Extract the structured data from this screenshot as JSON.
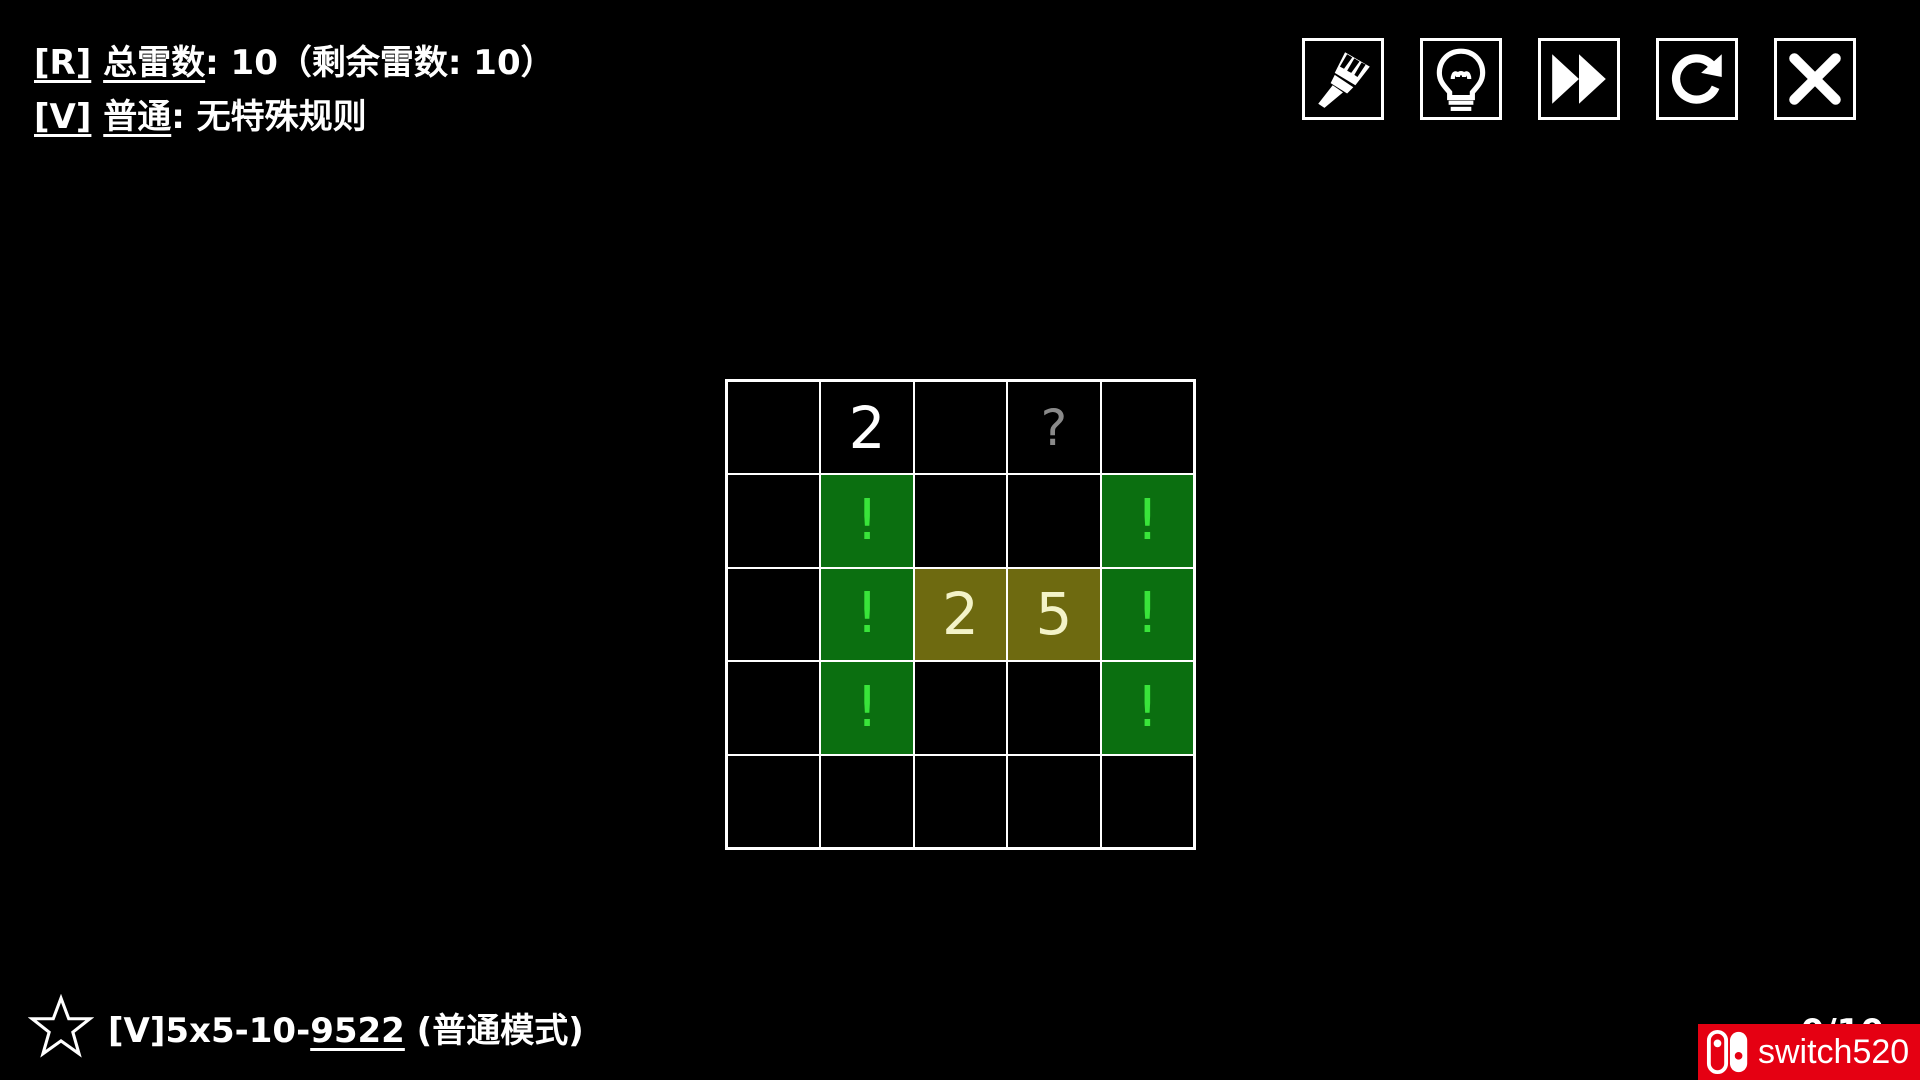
{
  "info": {
    "line1_key": "[R]",
    "line1_label": "总雷数",
    "line1_text": ":  10（剩余雷数: 10）",
    "line2_key": "[V]",
    "line2_label": "普通",
    "line2_text": ": 无特殊规则"
  },
  "toolbar": {
    "buttons": [
      {
        "name": "brush",
        "icon": "brush-icon"
      },
      {
        "name": "hint",
        "icon": "lightbulb-icon"
      },
      {
        "name": "skip",
        "icon": "fast-forward-icon"
      },
      {
        "name": "restart",
        "icon": "refresh-icon"
      },
      {
        "name": "close",
        "icon": "close-icon"
      }
    ]
  },
  "board": {
    "rows": 5,
    "cols": 5,
    "cells": [
      [
        {
          "type": "empty",
          "text": ""
        },
        {
          "type": "number",
          "text": "2"
        },
        {
          "type": "empty",
          "text": ""
        },
        {
          "type": "unknown",
          "text": "?"
        },
        {
          "type": "empty",
          "text": ""
        }
      ],
      [
        {
          "type": "empty",
          "text": ""
        },
        {
          "type": "flag",
          "text": "!"
        },
        {
          "type": "empty",
          "text": ""
        },
        {
          "type": "empty",
          "text": ""
        },
        {
          "type": "flag",
          "text": "!"
        }
      ],
      [
        {
          "type": "empty",
          "text": ""
        },
        {
          "type": "flag",
          "text": "!"
        },
        {
          "type": "highlight",
          "text": "2"
        },
        {
          "type": "highlight",
          "text": "5"
        },
        {
          "type": "flag",
          "text": "!"
        }
      ],
      [
        {
          "type": "empty",
          "text": ""
        },
        {
          "type": "flag",
          "text": "!"
        },
        {
          "type": "empty",
          "text": ""
        },
        {
          "type": "empty",
          "text": ""
        },
        {
          "type": "flag",
          "text": "!"
        }
      ],
      [
        {
          "type": "empty",
          "text": ""
        },
        {
          "type": "empty",
          "text": ""
        },
        {
          "type": "empty",
          "text": ""
        },
        {
          "type": "empty",
          "text": ""
        },
        {
          "type": "empty",
          "text": ""
        }
      ]
    ]
  },
  "footer": {
    "level_prefix": "[V]5x5-10-",
    "level_id": "9522",
    "level_suffix": " (普通模式)",
    "progress": "0/10"
  },
  "watermark": {
    "text": "switch520"
  },
  "colors": {
    "background": "#000000",
    "flag_bg": "#0b6f10",
    "flag_fg": "#39e43a",
    "highlight_bg": "#6e6a10",
    "watermark_bg": "#e50012"
  }
}
